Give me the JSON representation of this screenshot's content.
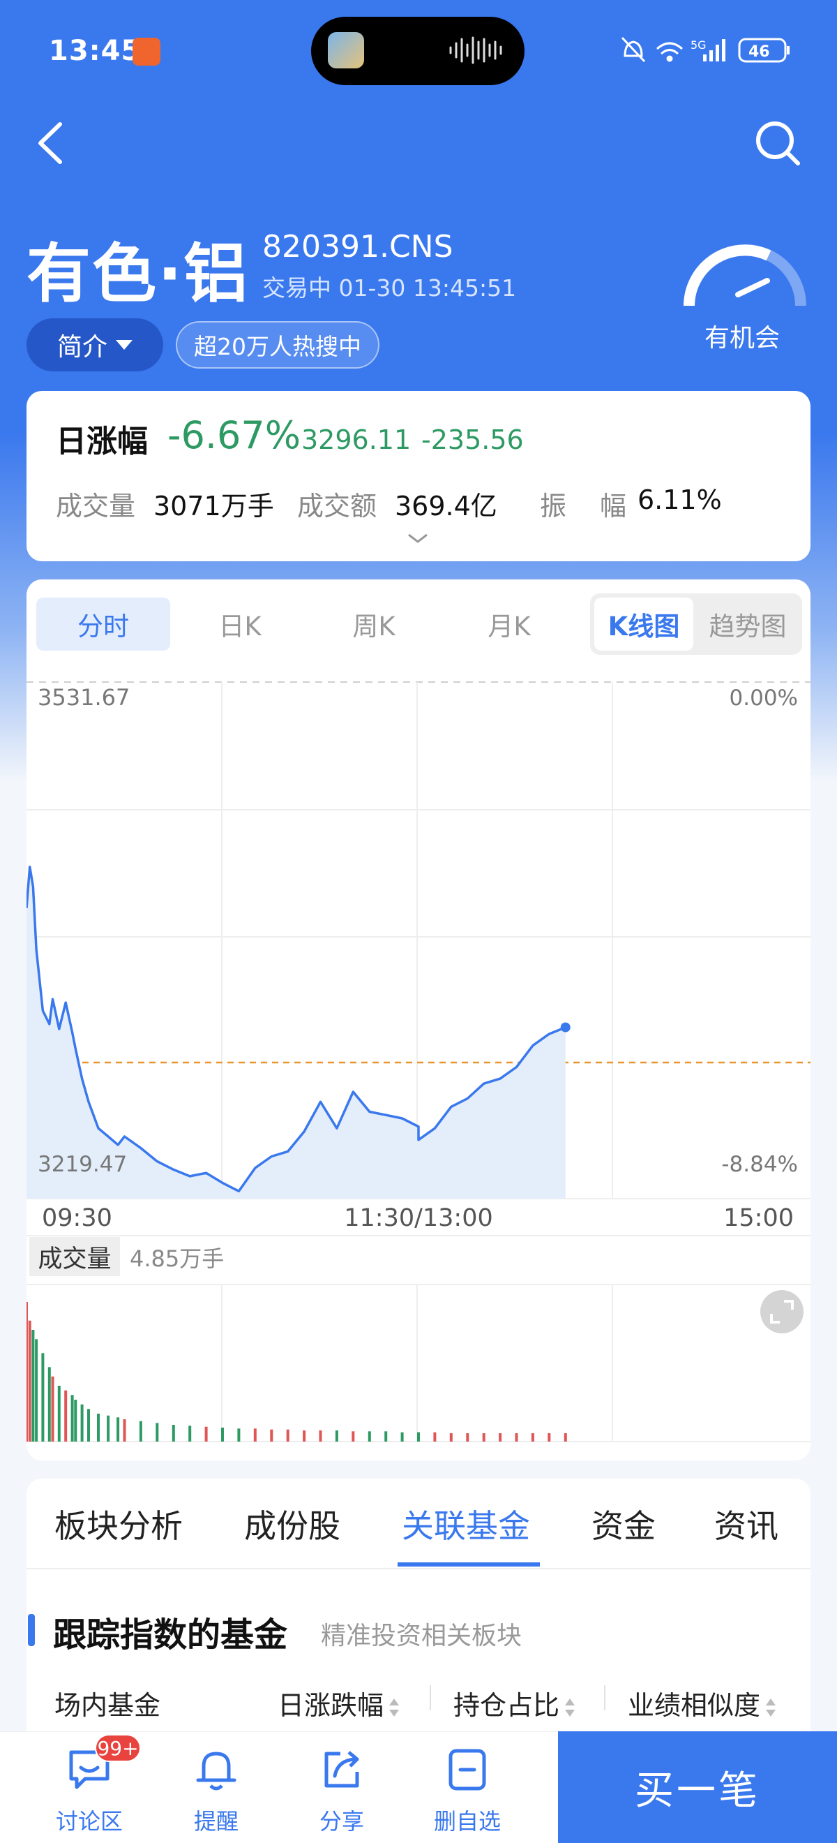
{
  "status_bar": {
    "time": "13:45",
    "battery": "46",
    "network": "5G"
  },
  "header": {
    "title": "有色·铝",
    "code": "820391.CNS",
    "trade_status": "交易中 01-30 13:45:51",
    "gauge_label": "有机会",
    "intro_label": "简介",
    "hot_tag": "超20万人热搜中"
  },
  "summary": {
    "label": "日涨幅",
    "pct": "-6.67%",
    "price": "3296.11",
    "change": "-235.56",
    "volume_label": "成交量",
    "volume": "3071万手",
    "amount_label": "成交额",
    "amount": "369.4亿",
    "amp_label_1": "振",
    "amp_label_2": "幅",
    "amplitude": "6.11%",
    "colors": {
      "down": "#2e9a63"
    }
  },
  "chart_tabs": {
    "tabs": [
      "分时",
      "日K",
      "周K",
      "月K"
    ],
    "active": "分时",
    "mode_a": "K线图",
    "mode_b": "趋势图"
  },
  "chart_labels": {
    "y_top": "3531.67",
    "y_bottom": "3219.47",
    "pct_top": "0.00%",
    "pct_bottom": "-8.84%",
    "x_start": "09:30",
    "x_mid": "11:30/13:00",
    "x_end": "15:00",
    "volume_label": "成交量",
    "volume_value": "4.85万手"
  },
  "chart_data": {
    "type": "line",
    "ylim": [
      3219.47,
      3531.67
    ],
    "prev_close": 3531.67,
    "x": [
      "09:30",
      "09:31",
      "09:32",
      "09:33",
      "09:35",
      "09:37",
      "09:38",
      "09:40",
      "09:42",
      "09:44",
      "09:45",
      "09:47",
      "09:49",
      "09:52",
      "09:55",
      "09:58",
      "10:00",
      "10:05",
      "10:10",
      "10:15",
      "10:20",
      "10:25",
      "10:30",
      "10:35",
      "10:40",
      "10:45",
      "10:50",
      "10:55",
      "11:00",
      "11:05",
      "11:10",
      "11:15",
      "11:20",
      "11:25",
      "11:30",
      "13:00",
      "13:05",
      "13:10",
      "13:15",
      "13:20",
      "13:25",
      "13:30",
      "13:35",
      "13:40",
      "13:45"
    ],
    "values": [
      3395,
      3420,
      3408,
      3370,
      3333,
      3325,
      3340,
      3322,
      3338,
      3320,
      3310,
      3292,
      3278,
      3262,
      3257,
      3252,
      3257,
      3250,
      3242,
      3237,
      3233,
      3235,
      3229,
      3224,
      3238,
      3245,
      3248,
      3260,
      3278,
      3262,
      3284,
      3272,
      3270,
      3268,
      3263,
      3255,
      3262,
      3275,
      3280,
      3289,
      3292,
      3299,
      3312,
      3319,
      3323
    ],
    "volume": [
      150,
      130,
      120,
      110,
      95,
      80,
      70,
      60,
      55,
      50,
      45,
      40,
      35,
      30,
      28,
      26,
      24,
      22,
      20,
      18,
      17,
      16,
      15,
      14,
      14,
      13,
      13,
      12,
      12,
      12,
      11,
      11,
      11,
      10,
      10,
      10,
      10,
      9,
      9,
      9,
      9,
      9,
      9,
      9,
      9
    ]
  },
  "section_tabs": {
    "tabs": [
      "板块分析",
      "成份股",
      "关联基金",
      "资金",
      "资讯"
    ],
    "active": "关联基金"
  },
  "fund_section": {
    "title": "跟踪指数的基金",
    "subtitle": "精准投资相关板块",
    "columns": [
      "场内基金",
      "日涨跌幅",
      "持仓占比",
      "业绩相似度"
    ]
  },
  "bottom_bar": {
    "items": [
      {
        "label": "讨论区",
        "icon": "chat-icon"
      },
      {
        "label": "提醒",
        "icon": "bell-icon"
      },
      {
        "label": "分享",
        "icon": "share-icon"
      },
      {
        "label": "删自选",
        "icon": "remove-watchlist-icon"
      }
    ],
    "badge": "99+",
    "buy_label": "买一笔",
    "accent": "#3a78ee"
  }
}
